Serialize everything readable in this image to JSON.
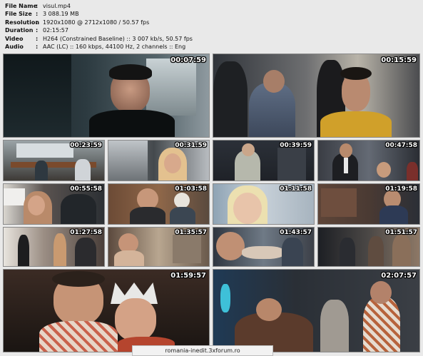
{
  "info": {
    "rows": [
      {
        "key": "File Name",
        "sep": ":",
        "value": "visul.mp4"
      },
      {
        "key": "File Size",
        "sep": ":",
        "value": "3 088.19 MB"
      },
      {
        "key": "Resolution",
        "sep": ":",
        "value": "1920x1080 @ 2712x1080 / 50.57 fps"
      },
      {
        "key": "Duration",
        "sep": ":",
        "value": "02:15:57"
      },
      {
        "key": "Video",
        "sep": ":",
        "value": "H264 (Constrained Baseline) :: 3 007 kb/s, 50.57 fps"
      },
      {
        "key": "Audio",
        "sep": ":",
        "value": "AAC (LC) :: 160 kbps, 44100 Hz, 2 channels :: Eng"
      }
    ]
  },
  "thumbnails": [
    {
      "time": "00:07:59"
    },
    {
      "time": "00:15:59"
    },
    {
      "time": "00:23:59"
    },
    {
      "time": "00:31:59"
    },
    {
      "time": "00:39:59"
    },
    {
      "time": "00:47:58"
    },
    {
      "time": "00:55:58"
    },
    {
      "time": "01:03:58"
    },
    {
      "time": "01:11:58"
    },
    {
      "time": "01:19:58"
    },
    {
      "time": "01:27:58"
    },
    {
      "time": "01:35:57"
    },
    {
      "time": "01:43:57"
    },
    {
      "time": "01:51:57"
    },
    {
      "time": "01:59:57"
    },
    {
      "time": "02:07:57"
    }
  ],
  "watermark": {
    "text": "romania-inedit.3xforum.ro"
  }
}
